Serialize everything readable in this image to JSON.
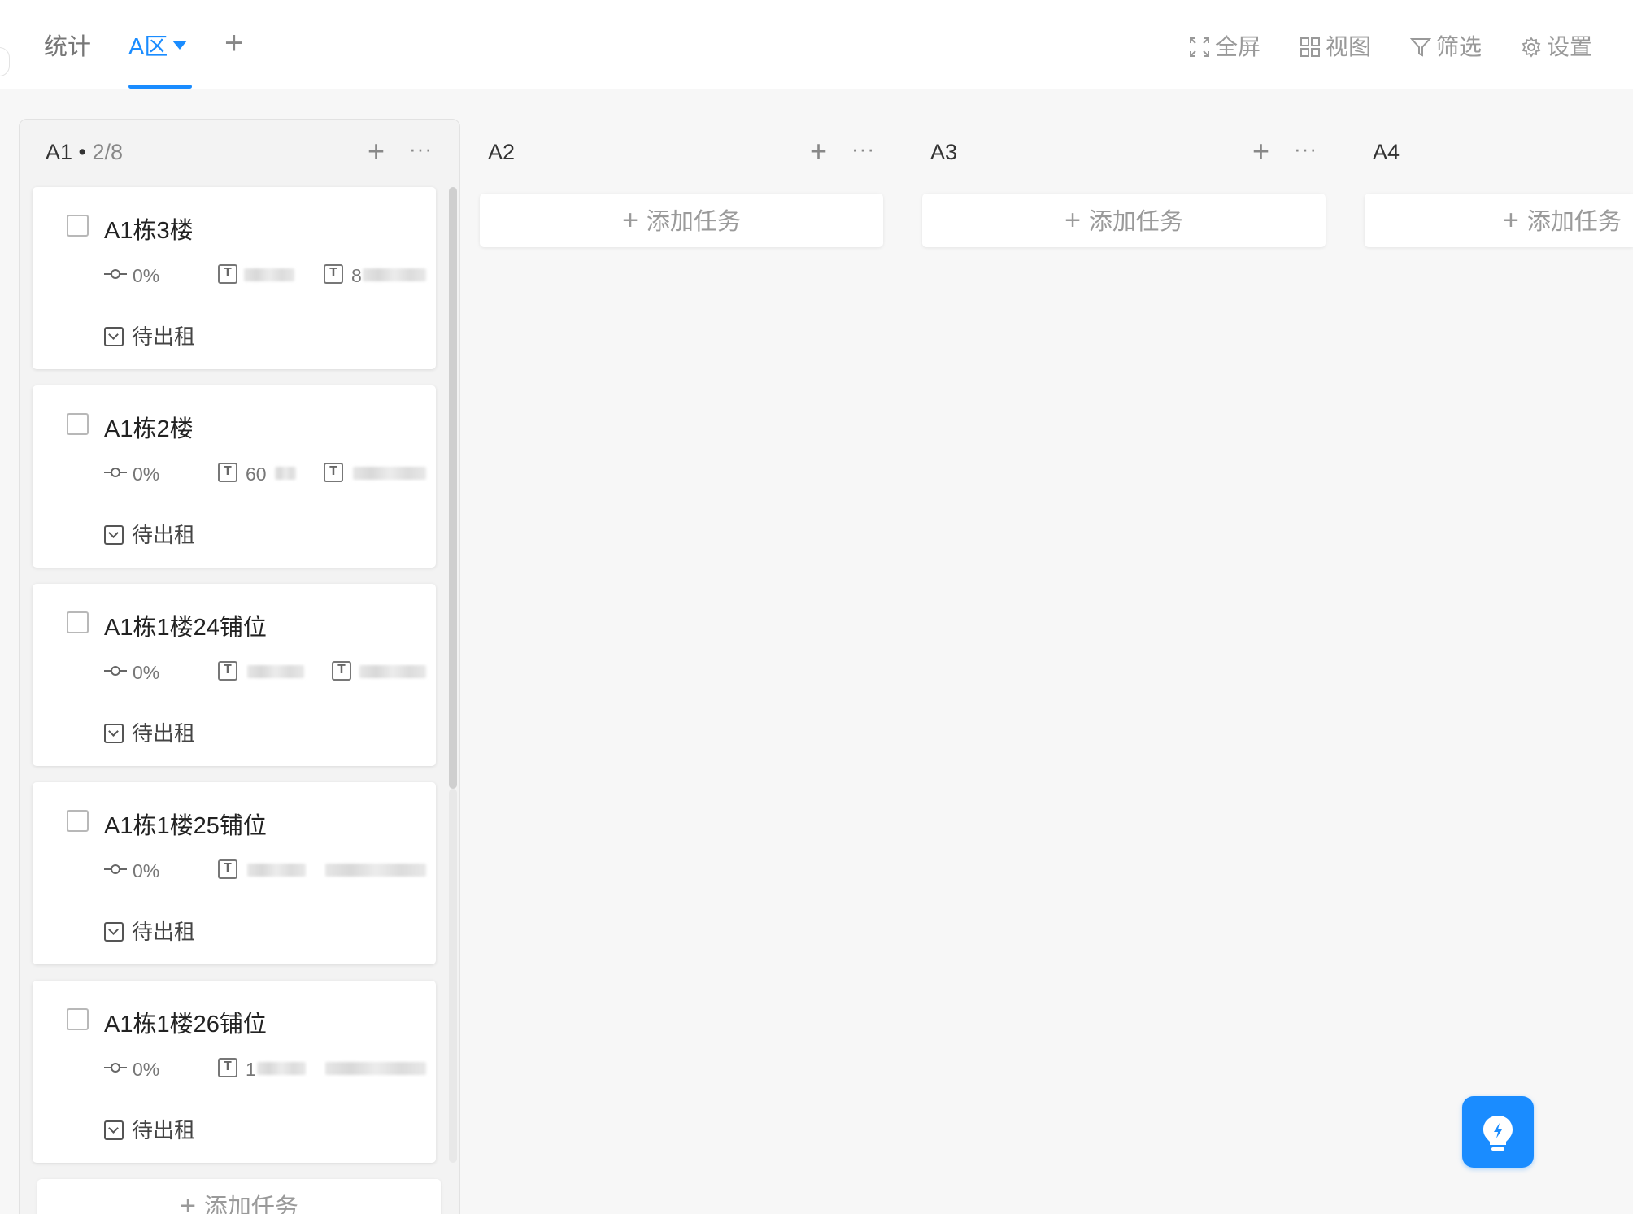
{
  "header": {
    "tabs": [
      {
        "label": "统计",
        "active": false
      },
      {
        "label": "A区",
        "active": true
      }
    ],
    "add_tab_symbol": "+",
    "tools": [
      {
        "label": "全屏",
        "icon": "fullscreen-icon"
      },
      {
        "label": "视图",
        "icon": "grid-view-icon"
      },
      {
        "label": "筛选",
        "icon": "filter-icon"
      },
      {
        "label": "设置",
        "icon": "gear-icon"
      }
    ]
  },
  "columns": [
    {
      "name": "A1",
      "count": "2/8",
      "plus": "+",
      "more": "···"
    },
    {
      "name": "A2",
      "plus": "+",
      "more": "···"
    },
    {
      "name": "A3",
      "plus": "+",
      "more": "···"
    },
    {
      "name": "A4"
    }
  ],
  "add_task_label": "添加任务",
  "cards": [
    {
      "title": "A1栋3楼",
      "progress": "0%",
      "field1": "",
      "field2": "8",
      "status": "待出租"
    },
    {
      "title": "A1栋2楼",
      "progress": "0%",
      "field1": "60",
      "field2": "",
      "status": "待出租"
    },
    {
      "title": "A1栋1楼24铺位",
      "progress": "0%",
      "field1": "",
      "field2": "",
      "status": "待出租"
    },
    {
      "title": "A1栋1楼25铺位",
      "progress": "0%",
      "field1": "",
      "field2": "",
      "status": "待出租"
    },
    {
      "title": "A1栋1楼26铺位",
      "progress": "0%",
      "field1": "1",
      "field2": "",
      "status": "待出租"
    }
  ],
  "colors": {
    "accent": "#1a8cff",
    "background": "#f7f7f7",
    "card": "#ffffff"
  }
}
